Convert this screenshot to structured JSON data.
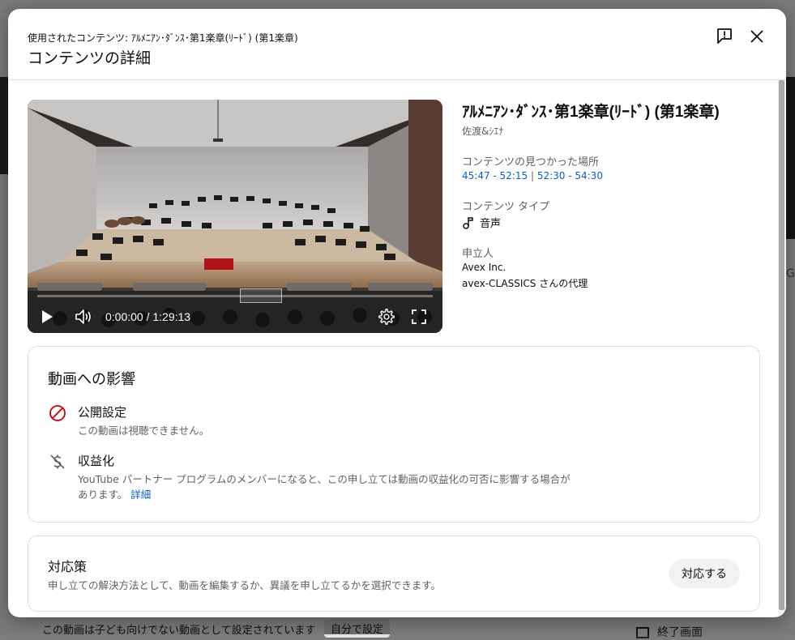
{
  "background": {
    "bottom_text": "この動画は子ども向けでない動画として設定されています",
    "bottom_button": "自分で設定",
    "bottom_right_text": "終了画面",
    "right_letter": "G"
  },
  "dialog": {
    "subtitle": "使用されたコンテンツ: ｱﾙﾒﾆｱﾝ･ﾀﾞﾝｽ･第1楽章(ﾘｰﾄﾞ) (第1楽章)",
    "title": "コンテンツの詳細",
    "feedback_icon": "report-flag-icon",
    "close_icon": "close-icon"
  },
  "video": {
    "time_display": "0:00:00 / 1:29:13",
    "progress": 0
  },
  "content_info": {
    "title": "ｱﾙﾒﾆｱﾝ･ﾀﾞﾝｽ･第1楽章(ﾘｰﾄﾞ) (第1楽章)",
    "artist": "佐渡&ｼｴﾅ",
    "location_label": "コンテンツの見つかった場所",
    "location_range_1": "45:47 - 52:15",
    "location_separator": "|",
    "location_range_2": "52:30 - 54:30",
    "type_label": "コンテンツ タイプ",
    "type_value": "音声",
    "claimant_label": "申立人",
    "claimant_name": "Avex Inc.",
    "claimant_on_behalf": "avex-CLASSICS さんの代理"
  },
  "impact": {
    "title": "動画への影響",
    "visibility_label": "公開設定",
    "visibility_desc": "この動画は視聴できません。",
    "monetization_label": "収益化",
    "monetization_desc": "YouTube パートナー プログラムのメンバーになると、この申し立ては動画の収益化の可否に影響する場合があります。",
    "monetization_link": "詳細"
  },
  "actions": {
    "title": "対応策",
    "desc": "申し立ての解決方法として、動画を編集するか、異議を申し立てるかを選択できます。",
    "button_label": "対応する"
  }
}
